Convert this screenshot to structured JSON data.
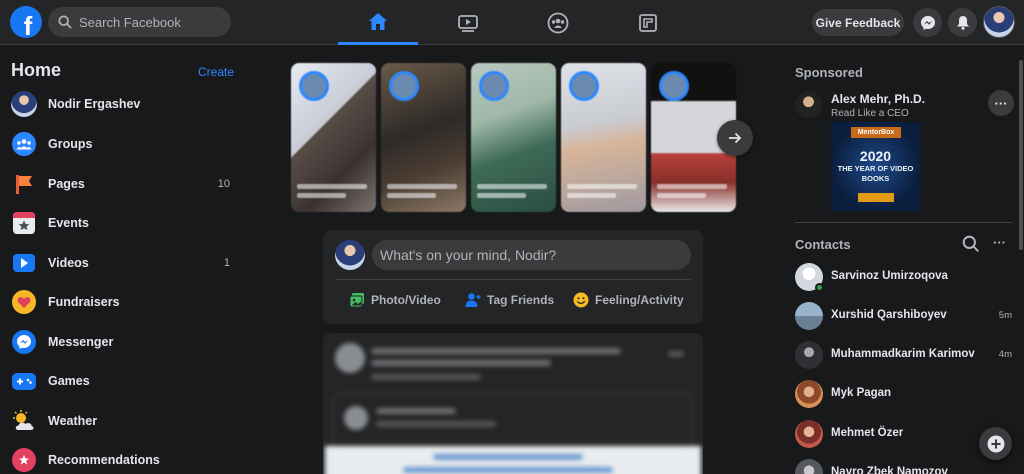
{
  "header": {
    "logo": "f",
    "search_placeholder": "Search Facebook",
    "tabs": [
      {
        "name": "home",
        "icon": "home-icon",
        "active": true
      },
      {
        "name": "watch",
        "icon": "video-icon",
        "active": false
      },
      {
        "name": "groups",
        "icon": "groups-icon",
        "active": false
      },
      {
        "name": "gaming",
        "icon": "gaming-icon",
        "active": false
      }
    ],
    "feedback_label": "Give Feedback"
  },
  "sidebar": {
    "title": "Home",
    "create_label": "Create",
    "items": [
      {
        "label": "Nodir Ergashev",
        "icon": "profile-avatar",
        "count": ""
      },
      {
        "label": "Groups",
        "icon": "groups-icon",
        "count": ""
      },
      {
        "label": "Pages",
        "icon": "flag-icon",
        "count": "10"
      },
      {
        "label": "Events",
        "icon": "calendar-star-icon",
        "count": ""
      },
      {
        "label": "Videos",
        "icon": "play-icon",
        "count": "1"
      },
      {
        "label": "Fundraisers",
        "icon": "heart-icon",
        "count": ""
      },
      {
        "label": "Messenger",
        "icon": "messenger-icon",
        "count": ""
      },
      {
        "label": "Games",
        "icon": "gamepad-icon",
        "count": ""
      },
      {
        "label": "Weather",
        "icon": "weather-icon",
        "count": ""
      },
      {
        "label": "Recommendations",
        "icon": "recommendations-icon",
        "count": ""
      }
    ]
  },
  "composer": {
    "placeholder": "What's on your mind, Nodir?",
    "actions": [
      {
        "label": "Photo/Video",
        "icon": "photo-icon",
        "color": "#45bd62"
      },
      {
        "label": "Tag Friends",
        "icon": "tag-friends-icon",
        "color": "#1877f2"
      },
      {
        "label": "Feeling/Activity",
        "icon": "smile-icon",
        "color": "#f7b928"
      }
    ]
  },
  "sponsored": {
    "title": "Sponsored",
    "advertiser": "Alex Mehr, Ph.D.",
    "subtitle": "Read Like a CEO",
    "more": "···",
    "ad_brand": "MentorBox",
    "ad_year": "2020",
    "ad_tagline": "THE YEAR OF VIDEO BOOKS"
  },
  "contacts": {
    "title": "Contacts",
    "more": "···",
    "list": [
      {
        "name": "Sarvinoz Umirzoqova",
        "time": "",
        "online": true,
        "color": "#dfe3ea"
      },
      {
        "name": "Xurshid Qarshiboyev",
        "time": "5m",
        "online": false,
        "color": "#8aa0b8"
      },
      {
        "name": "Muhammadkarim Karimov",
        "time": "4m",
        "online": false,
        "color": "#4a4d52"
      },
      {
        "name": "Myk Pagan",
        "time": "",
        "online": false,
        "color": "#c9703a"
      },
      {
        "name": "Mehmet Özer",
        "time": "",
        "online": false,
        "color": "#b5483b"
      },
      {
        "name": "Navro Zbek Namozov",
        "time": "",
        "online": false,
        "color": "#6b7077"
      }
    ]
  },
  "colors": {
    "accent": "#2d88ff",
    "background": "#18191a",
    "surface": "#242526"
  }
}
